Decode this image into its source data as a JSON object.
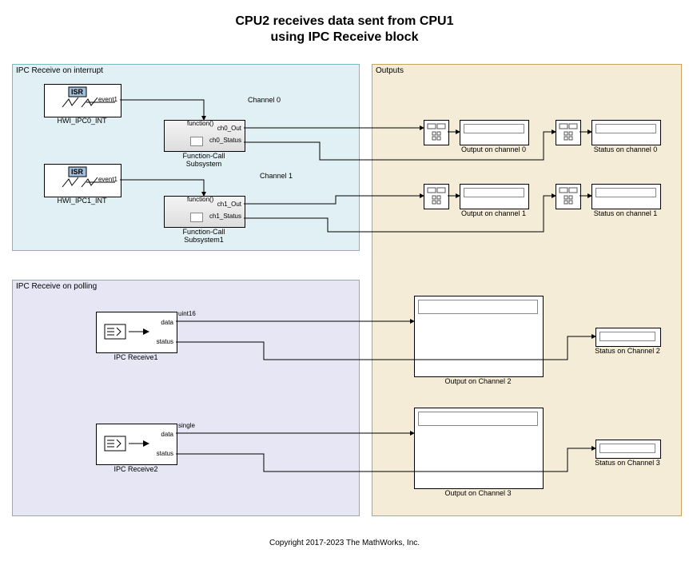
{
  "title": {
    "line1": "CPU2 receives data sent from CPU1",
    "line2": "using IPC Receive block"
  },
  "regions": {
    "interrupt": {
      "label": "IPC Receive on interrupt",
      "bg": "#e0f0f4",
      "border": "#7aa"
    },
    "polling": {
      "label": "IPC Receive on polling",
      "bg": "#e6e6f5",
      "border": "#99a"
    },
    "outputs": {
      "label": "Outputs",
      "bg": "#f5ecd7",
      "border": "#c9a35b"
    }
  },
  "blocks": {
    "hwi0": {
      "name": "HWI_IPC0_INT",
      "isr_label": "ISR",
      "port": "event1"
    },
    "hwi1": {
      "name": "HWI_IPC1_INT",
      "isr_label": "ISR",
      "port": "event1"
    },
    "fcs0": {
      "name": "Function-Call\nSubsystem",
      "trigger": "function()",
      "out1": "ch0_Out",
      "out2": "ch0_Status"
    },
    "fcs1": {
      "name": "Function-Call\nSubsystem1",
      "trigger": "function()",
      "out1": "ch1_Out",
      "out2": "ch1_Status"
    },
    "ipc1": {
      "name": "IPC Receive1",
      "out1": "data",
      "out2": "status",
      "dtype": "uint16"
    },
    "ipc2": {
      "name": "IPC Receive2",
      "out1": "data",
      "out2": "status",
      "dtype": "single"
    },
    "ch0_label": "Channel 0",
    "ch1_label": "Channel 1"
  },
  "outputs": {
    "scope0": {
      "name": "Output on channel 0"
    },
    "stat0": {
      "name": "Status on channel 0"
    },
    "scope1": {
      "name": "Output on channel 1"
    },
    "stat1": {
      "name": "Status on channel 1"
    },
    "scope2": {
      "name": "Output on Channel 2"
    },
    "stat2": {
      "name": "Status on Channel 2"
    },
    "scope3": {
      "name": "Output on Channel 3"
    },
    "stat3": {
      "name": "Status on Channel 3"
    }
  },
  "footer": "Copyright 2017-2023 The MathWorks, Inc."
}
